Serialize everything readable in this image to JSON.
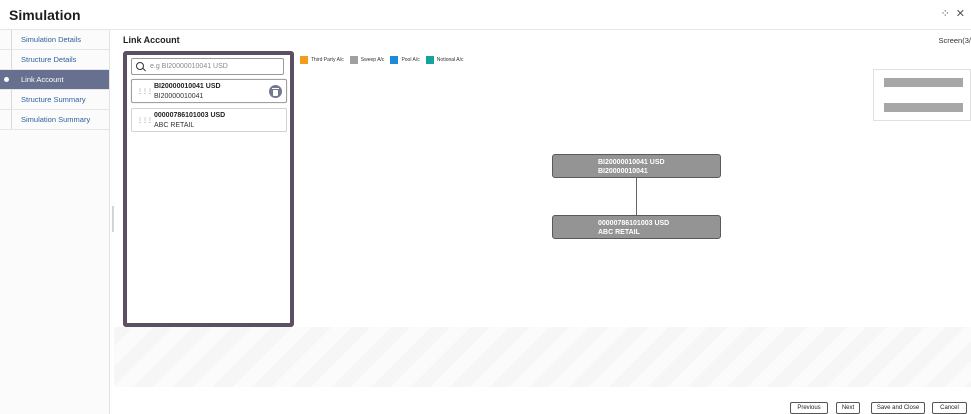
{
  "app": {
    "title": "Simulation"
  },
  "header_icons": [
    "fullscreen-icon",
    "close-icon"
  ],
  "sidebar": {
    "items": [
      {
        "label": "Simulation Details",
        "active": false
      },
      {
        "label": "Structure Details",
        "active": false
      },
      {
        "label": "Link Account",
        "active": true
      },
      {
        "label": "Structure Summary",
        "active": false
      },
      {
        "label": "Simulation Summary",
        "active": false
      }
    ]
  },
  "main": {
    "title": "Link Account",
    "screen_indicator": "Screen(3/"
  },
  "search": {
    "placeholder": "e.g BI20000010041 USD",
    "value": ""
  },
  "accounts": [
    {
      "line1": "BI20000010041 USD",
      "line2": "BI20000010041",
      "selected": true
    },
    {
      "line1": "00000786101003 USD",
      "line2": "ABC RETAIL",
      "selected": false
    }
  ],
  "legend": [
    {
      "label": "Third Party A/c",
      "color": "#f39c1e"
    },
    {
      "label": "Sweep A/c",
      "color": "#a0a0a0"
    },
    {
      "label": "Pool A/c",
      "color": "#1f8ad8"
    },
    {
      "label": "Notional A/c",
      "color": "#15a3a0"
    }
  ],
  "tree": {
    "parent": {
      "line1": "BI20000010041 USD",
      "line2": "BI20000010041"
    },
    "child": {
      "line1": "00000786101003 USD",
      "line2": "ABC RETAIL"
    }
  },
  "footer": {
    "previous": "Previous",
    "next": "Next",
    "save_close": "Save and Close",
    "cancel": "Cancel"
  }
}
